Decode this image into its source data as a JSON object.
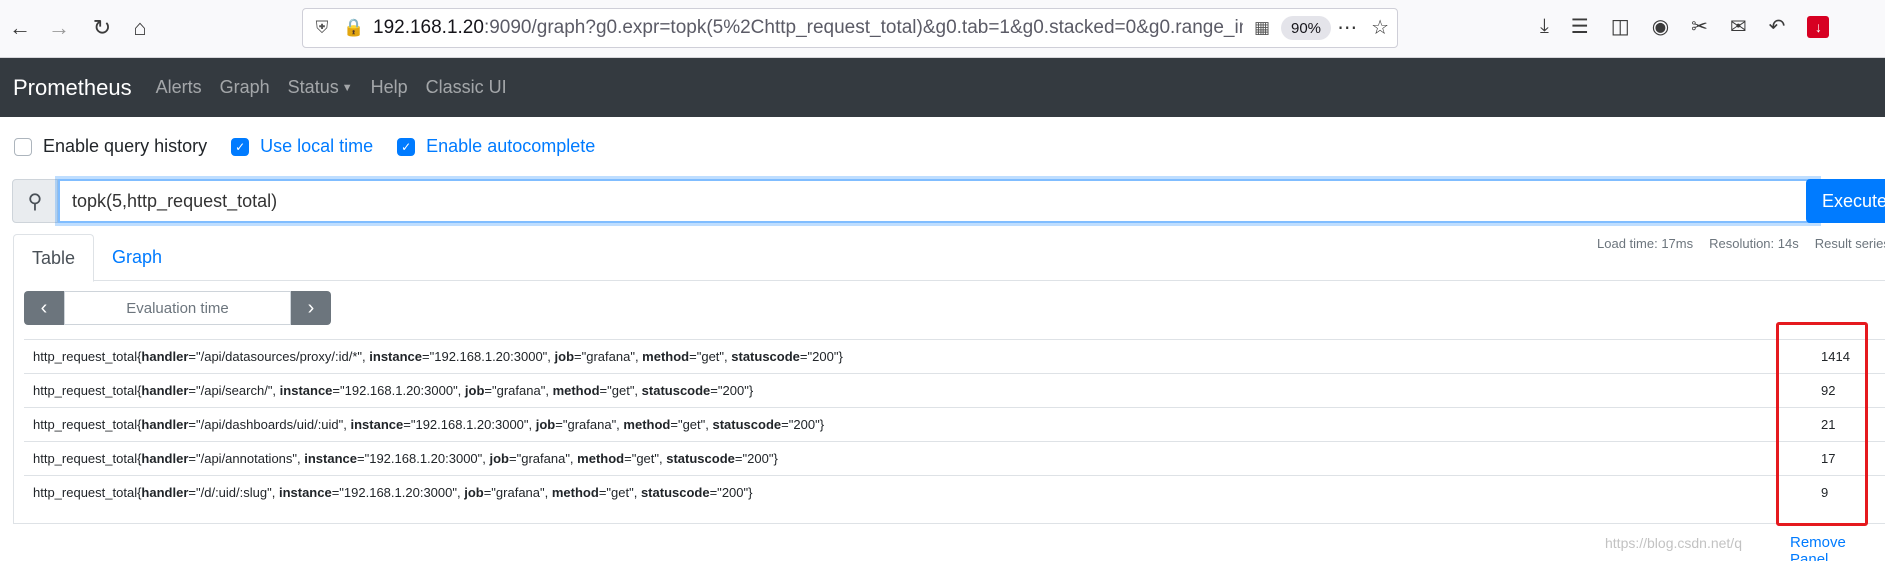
{
  "browser": {
    "url_host": "192.168.1.20",
    "url_rest": ":9090/graph?g0.expr=topk(5%2Chttp_request_total)&g0.tab=1&g0.stacked=0&g0.range_in",
    "zoom": "90%",
    "icons": [
      "back-arrow-icon",
      "forward-arrow-icon",
      "reload-icon",
      "home-icon",
      "shield-icon",
      "insecure-lock-icon",
      "qr-code-icon",
      "more-icon",
      "bookmark-star-icon",
      "download-icon",
      "library-icon",
      "sidebar-icon",
      "account-icon",
      "crop-icon",
      "chat-icon",
      "undo-icon",
      "extension-icon"
    ]
  },
  "navbar": {
    "brand": "Prometheus",
    "links": [
      "Alerts",
      "Graph",
      "Status",
      "Help",
      "Classic UI"
    ]
  },
  "options": {
    "query_history": {
      "label": "Enable query history",
      "checked": false
    },
    "local_time": {
      "label": "Use local time",
      "checked": true
    },
    "autocomplete": {
      "label": "Enable autocomplete",
      "checked": true
    }
  },
  "query": {
    "expression": "topk(5,http_request_total)",
    "execute_label": "Execute"
  },
  "tabs": {
    "table": "Table",
    "graph": "Graph",
    "active": "Table"
  },
  "stats": {
    "load_time": "Load time: 17ms",
    "resolution": "Resolution: 14s",
    "result_series": "Result series"
  },
  "eval": {
    "placeholder": "Evaluation time"
  },
  "results": [
    {
      "metric": "http_request_total",
      "handler": "/api/datasources/proxy/:id/*",
      "instance": "192.168.1.20:3000",
      "job": "grafana",
      "method": "get",
      "statuscode": "200",
      "value": "1414"
    },
    {
      "metric": "http_request_total",
      "handler": "/api/search/",
      "instance": "192.168.1.20:3000",
      "job": "grafana",
      "method": "get",
      "statuscode": "200",
      "value": "92"
    },
    {
      "metric": "http_request_total",
      "handler": "/api/dashboards/uid/:uid",
      "instance": "192.168.1.20:3000",
      "job": "grafana",
      "method": "get",
      "statuscode": "200",
      "value": "21"
    },
    {
      "metric": "http_request_total",
      "handler": "/api/annotations",
      "instance": "192.168.1.20:3000",
      "job": "grafana",
      "method": "get",
      "statuscode": "200",
      "value": "17"
    },
    {
      "metric": "http_request_total",
      "handler": "/d/:uid/:slug",
      "instance": "192.168.1.20:3000",
      "job": "grafana",
      "method": "get",
      "statuscode": "200",
      "value": "9"
    }
  ],
  "footer": {
    "remove_panel": "Remove Panel",
    "watermark": "https://blog.csdn.net/q"
  },
  "colors": {
    "navbar": "#343a40",
    "primary": "#007bff",
    "highlight": "#e5191e"
  }
}
